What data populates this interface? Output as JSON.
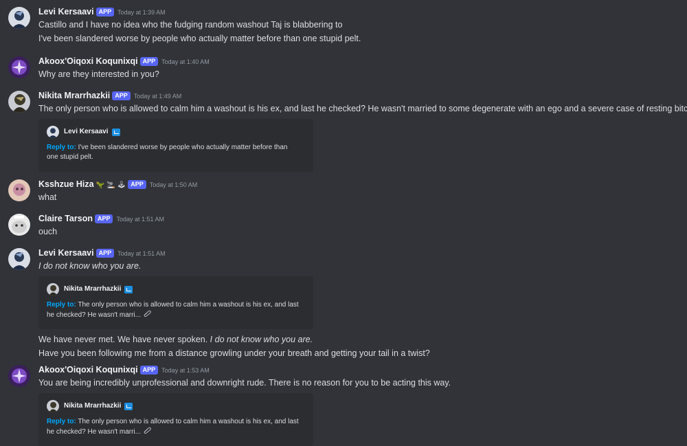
{
  "messages": [
    {
      "author": "Levi Kersaavi",
      "badge": "APP",
      "time": "Today at 1:39 AM",
      "lines": [
        "Castillo and I have no idea who the fudging random washout Taj is blabbering to",
        "I've been slandered worse by people who actually matter before than one stupid pelt."
      ]
    },
    {
      "author": "Akoox'Oiqoxi Koqunixqi",
      "badge": "APP",
      "time": "Today at 1:40 AM",
      "lines": [
        "Why are they interested in you?"
      ]
    },
    {
      "author": "Nikita Mrarrhazkii",
      "badge": "APP",
      "time": "Today at 1:49 AM",
      "lines": [
        "The only person who is allowed to calm him a washout is his ex, and last he checked? He wasn't married to some degenerate with an ego and a severe case of resting bitch face"
      ],
      "embed": {
        "author": "Levi Kersaavi",
        "reply_label": "Reply to:",
        "lines": [
          "I've been slandered worse by people who actually matter before than",
          "one stupid pelt."
        ]
      }
    },
    {
      "author": "Ksshzue Hiza",
      "emojis": [
        "🦖",
        "🚬",
        "🕹"
      ],
      "badge": "APP",
      "time": "Today at 1:50 AM",
      "lines": [
        "what"
      ]
    },
    {
      "author": "Claire Tarson",
      "badge": "APP",
      "time": "Today at 1:51 AM",
      "lines": [
        "ouch"
      ]
    },
    {
      "author": "Levi Kersaavi",
      "badge": "APP",
      "time": "Today at 1:51 AM",
      "lines_italic": "I do not know who you are.",
      "embed": {
        "author": "Nikita Mrarrhazkii",
        "reply_label": "Reply to:",
        "lines": [
          "The only person who is allowed to calm him a washout is his ex, and last",
          "he checked? He wasn't marri..."
        ]
      },
      "after_lines": {
        "line1_plain": "We have never met. We have never spoken. ",
        "line1_italic": "I do not know who you are.",
        "line2": "Have you been following me from a distance growling under your breath and getting your tail in a twist?"
      }
    },
    {
      "author": "Akoox'Oiqoxi Koqunixqi",
      "badge": "APP",
      "time": "Today at 1:53 AM",
      "lines": [
        "You are being incredibly unprofessional and downright rude. There is no reason for you to be acting this way."
      ],
      "embed": {
        "author": "Nikita Mrarrhazkii",
        "reply_label": "Reply to:",
        "lines": [
          "The only person who is allowed to calm him a washout is his ex, and last",
          "he checked? He wasn't marri..."
        ]
      }
    }
  ],
  "icons": {
    "attachment": "paperclip-icon",
    "verified": "bot-check-icon"
  }
}
